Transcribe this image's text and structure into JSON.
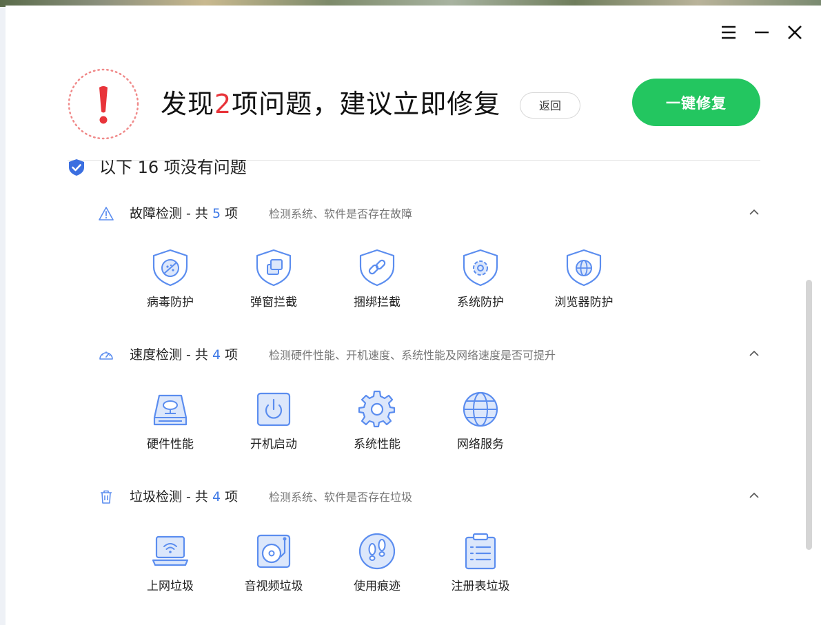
{
  "header": {
    "menu_icon": "menu-icon",
    "minimize_icon": "minimize-icon",
    "close_icon": "close-icon"
  },
  "alert": {
    "headline_prefix": "发现",
    "issue_count": "2",
    "headline_suffix": "项问题，建议立即修复",
    "back_label": "返回",
    "fix_label": "一键修复",
    "accent_color": "#e8343a",
    "fix_color": "#23c660"
  },
  "summary": {
    "ok_text": "以下 16 项没有问题"
  },
  "sections": [
    {
      "icon": "warning-icon",
      "title_prefix": "故障检测 - 共 ",
      "count": "5",
      "title_suffix": " 项",
      "desc": "检测系统、软件是否存在故障",
      "items": [
        {
          "label": "病毒防护",
          "icon": "virus-shield-icon"
        },
        {
          "label": "弹窗拦截",
          "icon": "popup-shield-icon"
        },
        {
          "label": "捆绑拦截",
          "icon": "link-shield-icon"
        },
        {
          "label": "系统防护",
          "icon": "gear-shield-icon"
        },
        {
          "label": "浏览器防护",
          "icon": "globe-shield-icon"
        }
      ]
    },
    {
      "icon": "speedometer-icon",
      "title_prefix": "速度检测 - 共 ",
      "count": "4",
      "title_suffix": " 项",
      "desc": "检测硬件性能、开机速度、系统性能及网络速度是否可提升",
      "items": [
        {
          "label": "硬件性能",
          "icon": "hardware-icon"
        },
        {
          "label": "开机启动",
          "icon": "power-icon"
        },
        {
          "label": "系统性能",
          "icon": "gear-icon"
        },
        {
          "label": "网络服务",
          "icon": "globe-icon"
        }
      ]
    },
    {
      "icon": "trash-icon",
      "title_prefix": "垃圾检测 - 共 ",
      "count": "4",
      "title_suffix": " 项",
      "desc": "检测系统、软件是否存在垃圾",
      "items": [
        {
          "label": "上网垃圾",
          "icon": "laptop-wifi-icon"
        },
        {
          "label": "音视频垃圾",
          "icon": "media-player-icon"
        },
        {
          "label": "使用痕迹",
          "icon": "footprints-icon"
        },
        {
          "label": "注册表垃圾",
          "icon": "clipboard-list-icon"
        }
      ]
    }
  ],
  "colors": {
    "icon_blue": "#5b8def",
    "icon_fill": "#dce7fb",
    "count_blue": "#3b77e6"
  }
}
